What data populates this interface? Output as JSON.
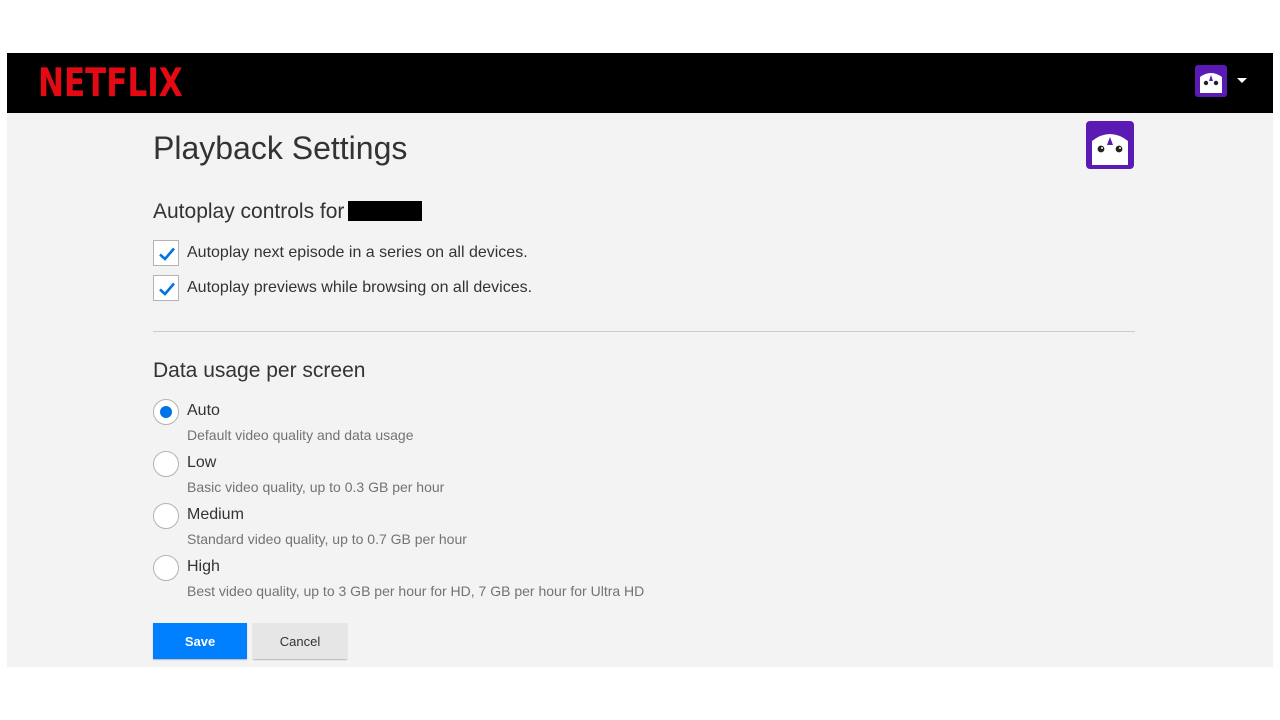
{
  "header": {
    "logo_text": "NETFLIX",
    "profile_icon": "penguin-avatar-icon",
    "dropdown_icon": "caret-down-icon"
  },
  "page": {
    "title": "Playback Settings"
  },
  "autoplay": {
    "title": "Autoplay controls for",
    "options": [
      {
        "label": "Autoplay next episode in a series on all devices.",
        "checked": true
      },
      {
        "label": "Autoplay previews while browsing on all devices.",
        "checked": true
      }
    ]
  },
  "data_usage": {
    "title": "Data usage per screen",
    "options": [
      {
        "label": "Auto",
        "desc": "Default video quality and data usage",
        "selected": true
      },
      {
        "label": "Low",
        "desc": "Basic video quality, up to 0.3 GB per hour",
        "selected": false
      },
      {
        "label": "Medium",
        "desc": "Standard video quality, up to 0.7 GB per hour",
        "selected": false
      },
      {
        "label": "High",
        "desc": "Best video quality, up to 3 GB per hour for HD, 7 GB per hour for Ultra HD",
        "selected": false
      }
    ]
  },
  "buttons": {
    "save": "Save",
    "cancel": "Cancel"
  },
  "colors": {
    "brand_red": "#e50914",
    "accent_blue": "#0080ff",
    "avatar_purple": "#5a1ab3"
  }
}
